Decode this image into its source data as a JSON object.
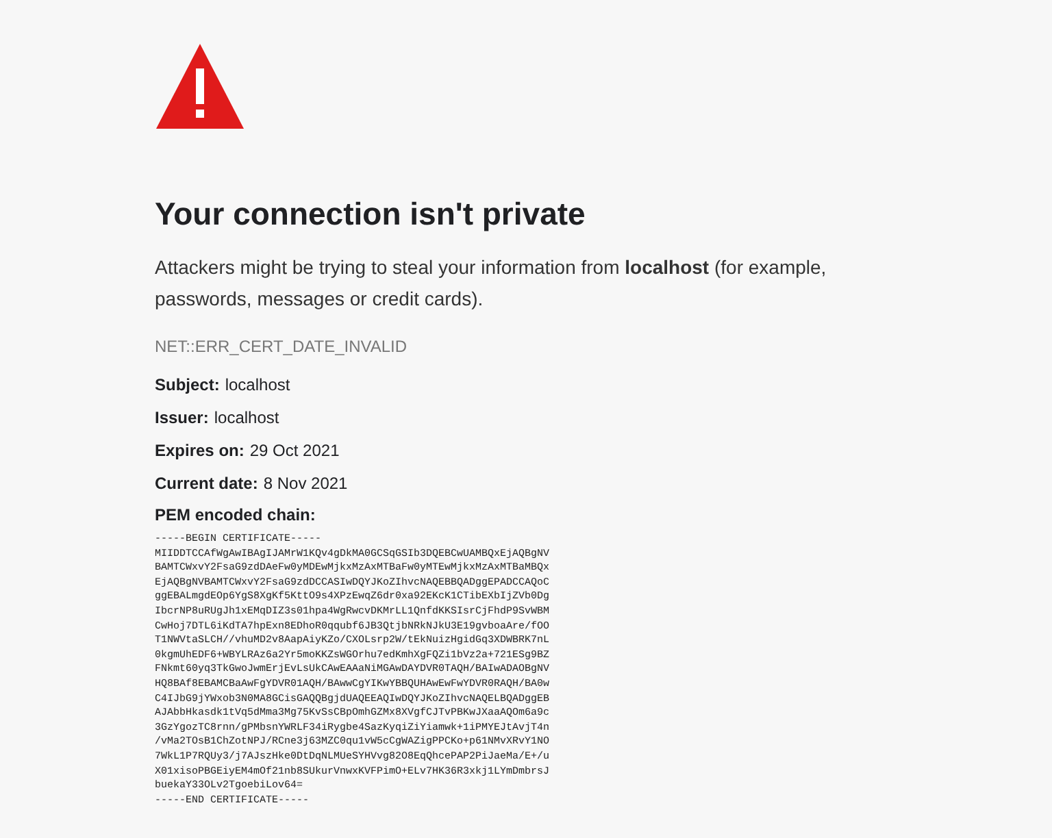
{
  "heading": "Your connection isn't private",
  "description": "Attackers might be trying to steal your information from **localhost** (for example, passwords, messages or credit cards).",
  "error_code": "NET::ERR_CERT_DATE_INVALID",
  "details": [
    {
      "label": "Subject:",
      "value": "localhost"
    },
    {
      "label": "Issuer:",
      "value": "localhost"
    },
    {
      "label": "Expires on:",
      "value": "29 Oct 2021"
    },
    {
      "label": "Current date:",
      "value": "8 Nov 2021"
    }
  ],
  "pem_label": "PEM encoded chain:",
  "certificate": [
    "-----BEGIN CERTIFICATE-----",
    "MIIDDTCCAfWgAwIBAgIJAMrW1KQv4gDkMA0GCSqGSIb3DQEBCwUAMBQxEjAQBgNV",
    "BAMTCWxvY2FsaG9zdDAeFw0yMDEwMjkxMzAxMTBaFw0yMTEwMjkxMzAxMTBaMBQx",
    "EjAQBgNVBAMTCWxvY2FsaG9zdDCCASIwDQYJKoZIhvcNAQEBBQADggEPADCCAQoC",
    "ggEBALmgdEOp6YgS8XgKf5KttO9s4XPzEwqZ6dr0xa92EKcK1CTibEXbIjZVb0Dg",
    "IbcrNP8uRUgJh1xEMqDIZ3s01hpa4WgRwcvDKMrLL1QnfdKKSIsrCjFhdP9SvWBM",
    "CwHoj7DTL6iKdTA7hpExn8EDhoR0qqubf6JB3QtjbNRkNJkU3E19gvboaAre/fOO",
    "T1NWVtaSLCH//vhuMD2v8AapAiyKZo/CXOLsrp2W/tEkNuizHgidGq3XDWBRK7nL",
    "0kgmUhEDF6+WBYLRAz6a2Yr5moKKZsWGOrhu7edKmhXgFQZi1bVz2a+721ESg9BZ",
    "FNkmt60yq3TkGwoJwmErjEvLsUkCAwEAAaNiMGAwDAYDVR0TAQH/BAIwADAOBgNV",
    "HQ8BAf8EBAMCBaAwFgYDVR01AQH/BAwwCgYIKwYBBQUHAwEwFwYDVR0RAQH/BA0w",
    "C4IJbG9jYWxob3N0MA8GCisGAQQBgjdUAQEEAQIwDQYJKoZIhvcNAQELBQADggEB",
    "AJAbbHkasdk1tVq5dMma3Mg75KvSsCBpOmhGZMx8XVgfCJTvPBKwJXaaAQOm6a9c",
    "3GzYgozTC8rnn/gPMbsnYWRLF34iRygbe4SazKyqiZiYiamwk+1iPMYEJtAvjT4n",
    "/vMa2TOsB1ChZotNPJ/RCne3j63MZC0qu1vW5cCgWAZigPPCKo+p61NMvXRvY1NO",
    "7WkL1P7RQUy3/j7AJszHke0DtDqNLMUeSYHVvg82O8EqQhcePAP2PiJaeMa/E+/u",
    "X01xisoPBGEiyEM4mOf21nb8SUkurVnwxKVFPimO+ELv7HK36R3xkj1LYmDmbrsJ",
    "buekaY33OLv2TgoebiLov64=",
    "-----END CERTIFICATE-----"
  ]
}
